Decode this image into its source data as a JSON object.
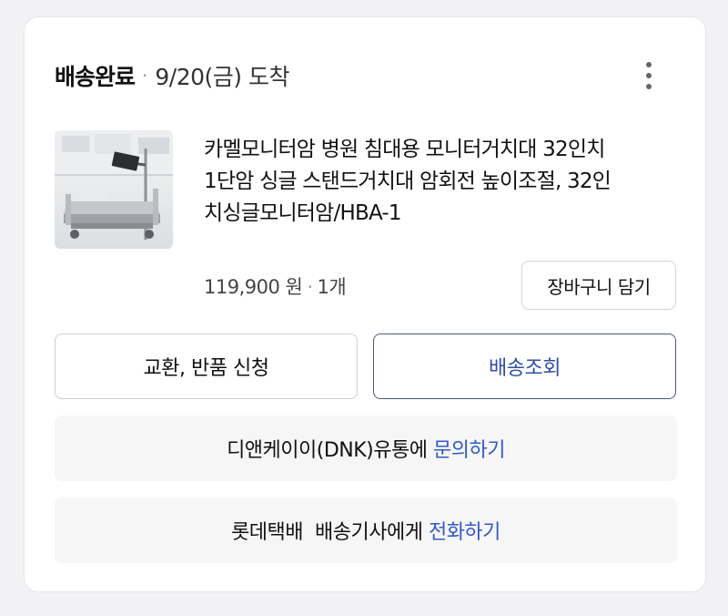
{
  "order": {
    "status": "배송완료",
    "separator": "·",
    "arrival": "9/20(금) 도착",
    "more_icon": "more-vertical-icon"
  },
  "product": {
    "name": "카멜모니터암 병원 침대용 모니터거치대 32인치\n1단암 싱글 스탠드거치대 암회전 높이조절, 32인\n치싱글모니터암/HBA-1",
    "price": "119,900 원",
    "separator": "·",
    "quantity": "1개",
    "thumbnail": "product-thumbnail-hospital-bed-monitor-arm"
  },
  "actions": {
    "cart_label": "장바구니 담기",
    "exchange_label": "교환, 반품 신청",
    "tracking_label": "배송조회"
  },
  "seller_contact": {
    "prefix": "디앤케이이(DNK)유통에 ",
    "link": "문의하기"
  },
  "courier_contact": {
    "prefix": "롯데택배  배송기사에게 ",
    "link": "전화하기"
  },
  "colors": {
    "link": "#3559c4",
    "tracking_border": "#4a5a77",
    "background": "#f2f2f4",
    "card": "#ffffff",
    "grey_row": "#f6f6f7"
  }
}
